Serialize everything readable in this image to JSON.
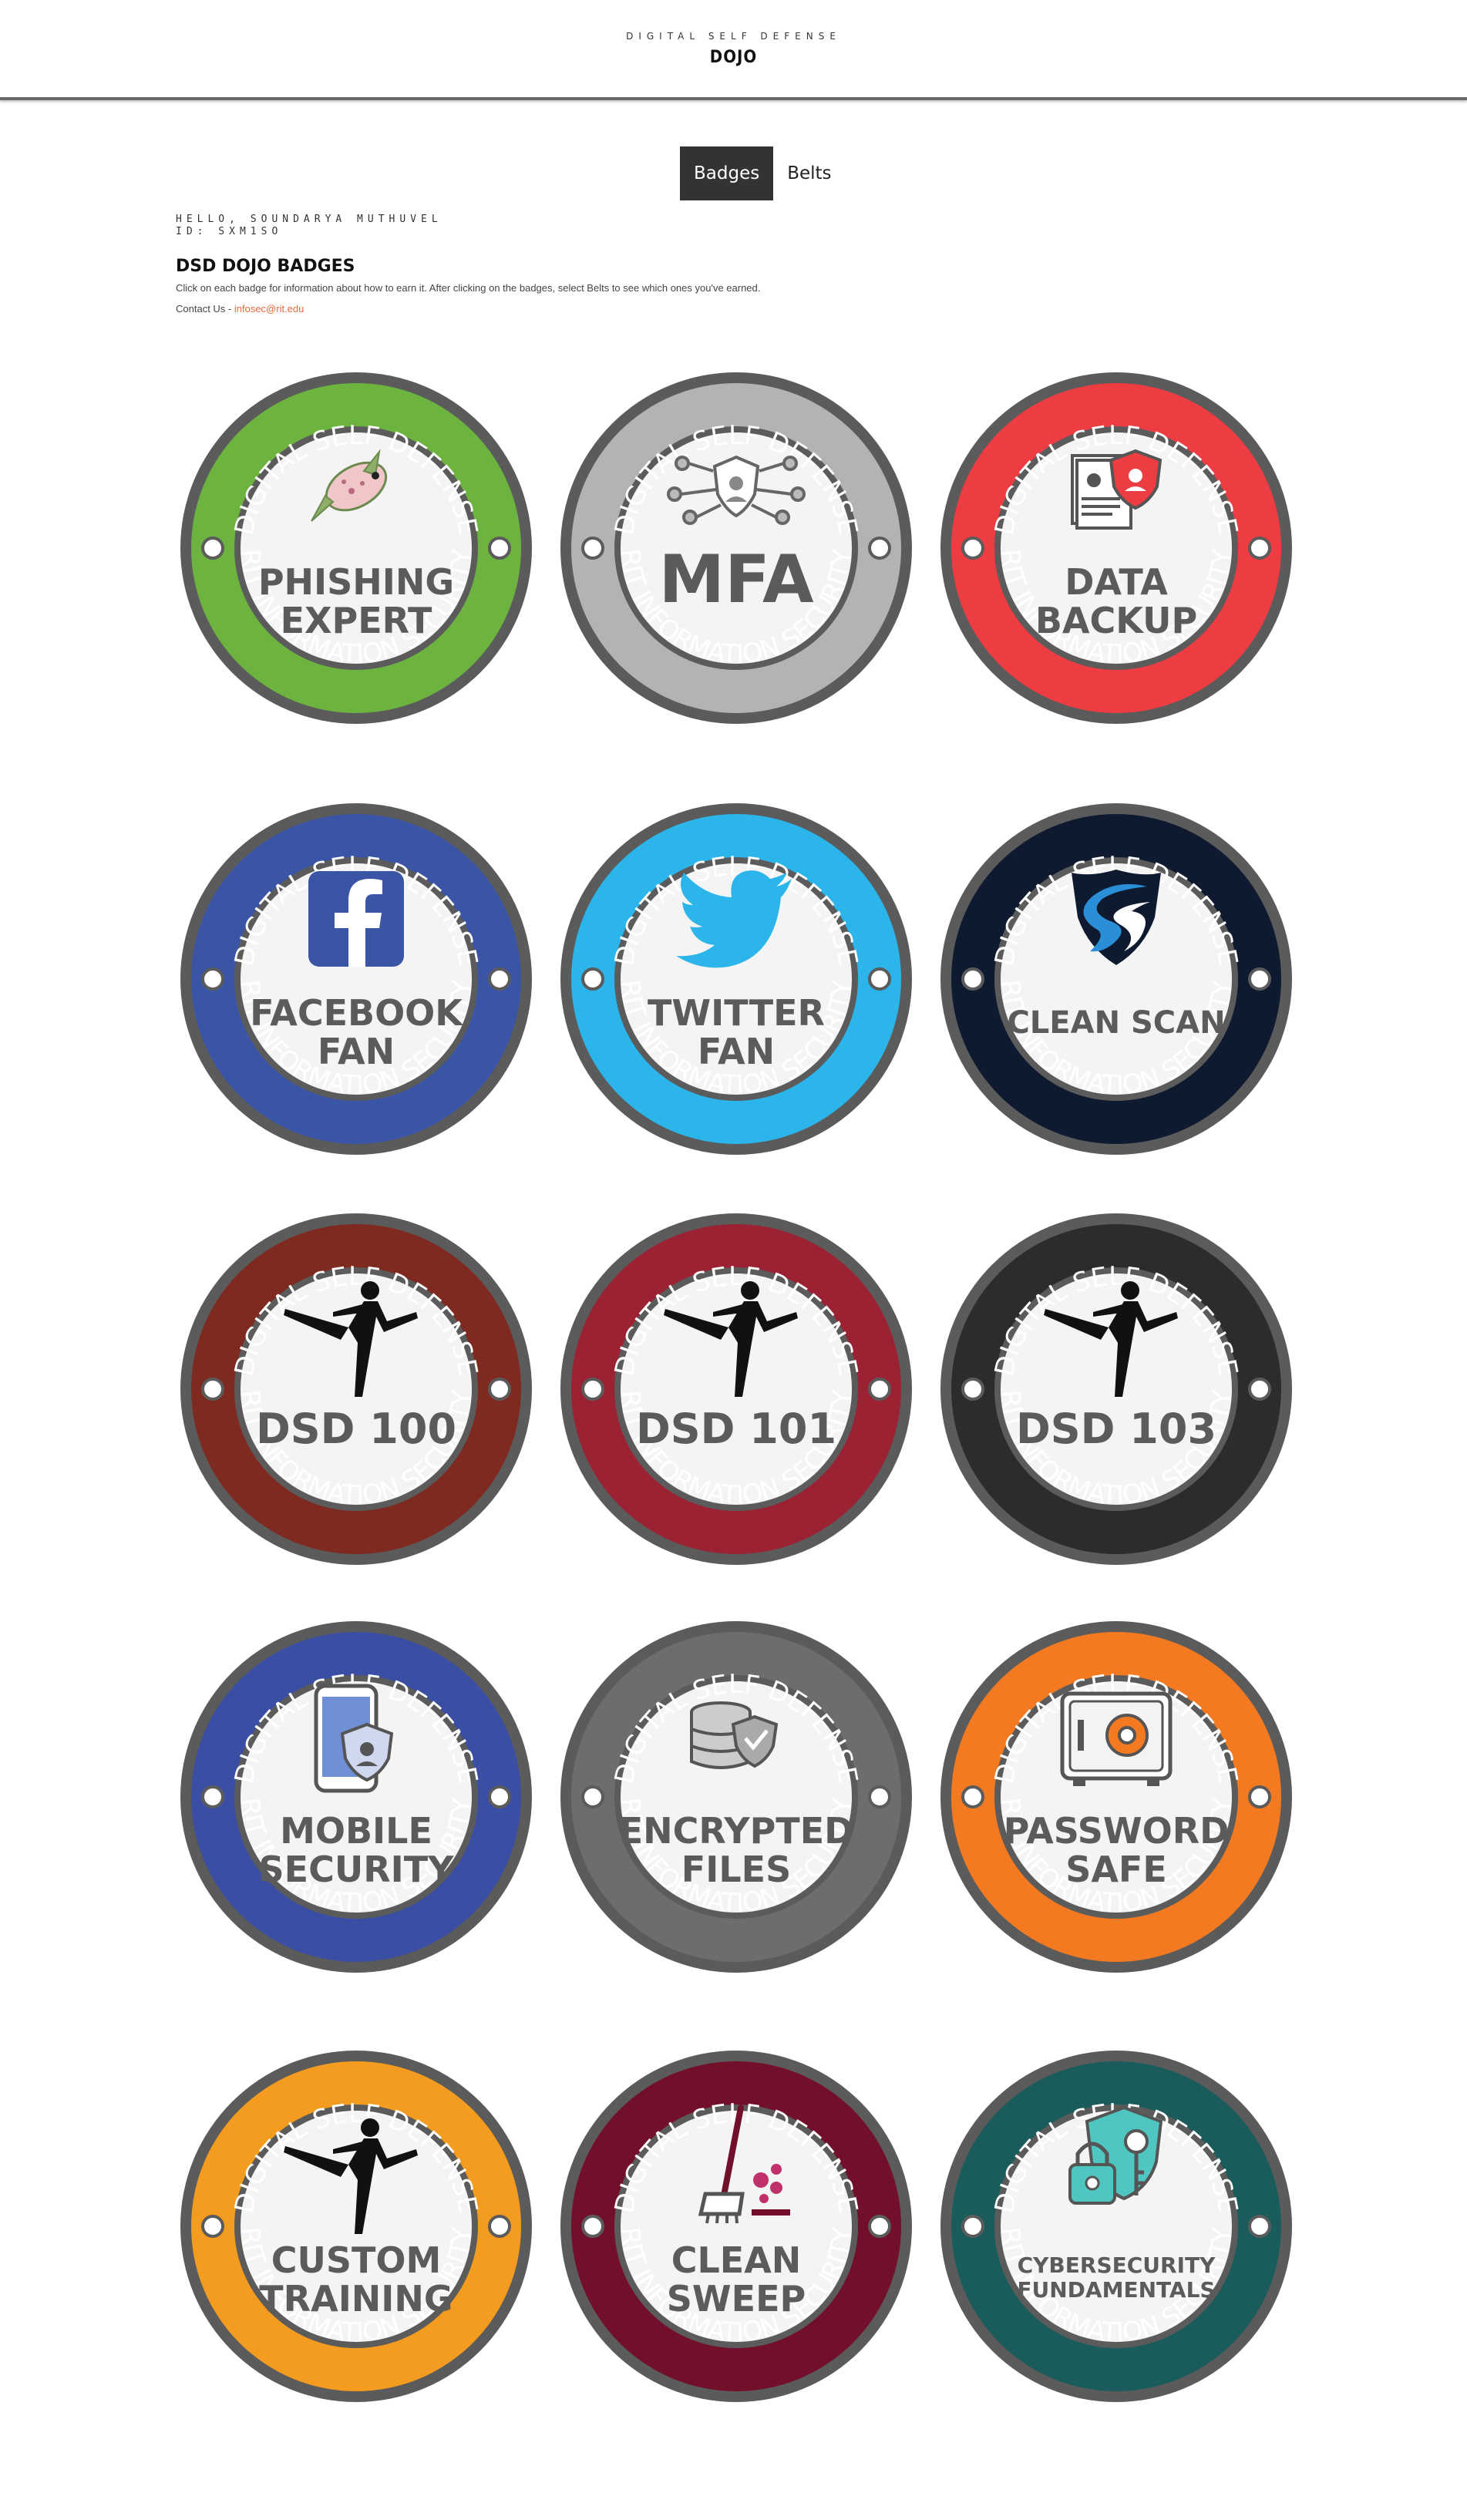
{
  "header": {
    "top": "DIGITAL SELF DEFENSE",
    "main": "DOJO"
  },
  "tabs": [
    {
      "label": "Badges",
      "active": true
    },
    {
      "label": "Belts",
      "active": false
    }
  ],
  "user": {
    "greeting": "HELLO, SOUNDARYA MUTHUVEL",
    "id": "ID: SXM1SO"
  },
  "page": {
    "title": "DSD DOJO BADGES",
    "description": "Click on each badge for information about how to earn it. After clicking on the badges, select Belts to see which ones you've earned.",
    "contact_label": "Contact Us - ",
    "contact_email": "infosec@rit.edu"
  },
  "badge_ring": {
    "top_text": "DIGITAL SELF DEFENSE",
    "bottom_text": "RIT INFORMATION SECURITY"
  },
  "badges": [
    {
      "line1": "PHISHING",
      "line2": "EXPERT",
      "color": "#6cb33f",
      "icon": "fish-icon"
    },
    {
      "line1": "MFA",
      "line2": "",
      "color": "#b3b3b3",
      "icon": "network-shield-icon"
    },
    {
      "line1": "DATA",
      "line2": "BACKUP",
      "color": "#ee3d42",
      "icon": "document-shield-icon"
    },
    {
      "line1": "FACEBOOK",
      "line2": "FAN",
      "color": "#3a55a6",
      "icon": "facebook-icon"
    },
    {
      "line1": "TWITTER",
      "line2": "FAN",
      "color": "#2cb5ea",
      "icon": "twitter-bird-icon"
    },
    {
      "line1": "CLEAN SCAN",
      "line2": "",
      "color": "#0e1a30",
      "icon": "s-shield-icon"
    },
    {
      "line1": "DSD 100",
      "line2": "",
      "color": "#7e2a20",
      "icon": "ninja-kick-icon"
    },
    {
      "line1": "DSD 101",
      "line2": "",
      "color": "#9b2233",
      "icon": "ninja-kick-icon"
    },
    {
      "line1": "DSD 103",
      "line2": "",
      "color": "#2c2c2c",
      "icon": "ninja-kick-icon"
    },
    {
      "line1": "MOBILE",
      "line2": "SECURITY",
      "color": "#3a4ea3",
      "icon": "phone-shield-icon"
    },
    {
      "line1": "ENCRYPTED",
      "line2": "FILES",
      "color": "#6d6d6d",
      "icon": "database-shield-icon"
    },
    {
      "line1": "PASSWORD",
      "line2": "SAFE",
      "color": "#f37a21",
      "icon": "safe-icon"
    },
    {
      "line1": "CUSTOM",
      "line2": "TRAINING",
      "color": "#f39c1f",
      "icon": "ninja-kick-icon"
    },
    {
      "line1": "CLEAN",
      "line2": "SWEEP",
      "color": "#72102c",
      "icon": "broom-icon"
    },
    {
      "line1": "CYBERSECURITY",
      "line2": "FUNDAMENTALS",
      "color": "#1a5c5b",
      "icon": "lock-key-shield-icon"
    }
  ]
}
